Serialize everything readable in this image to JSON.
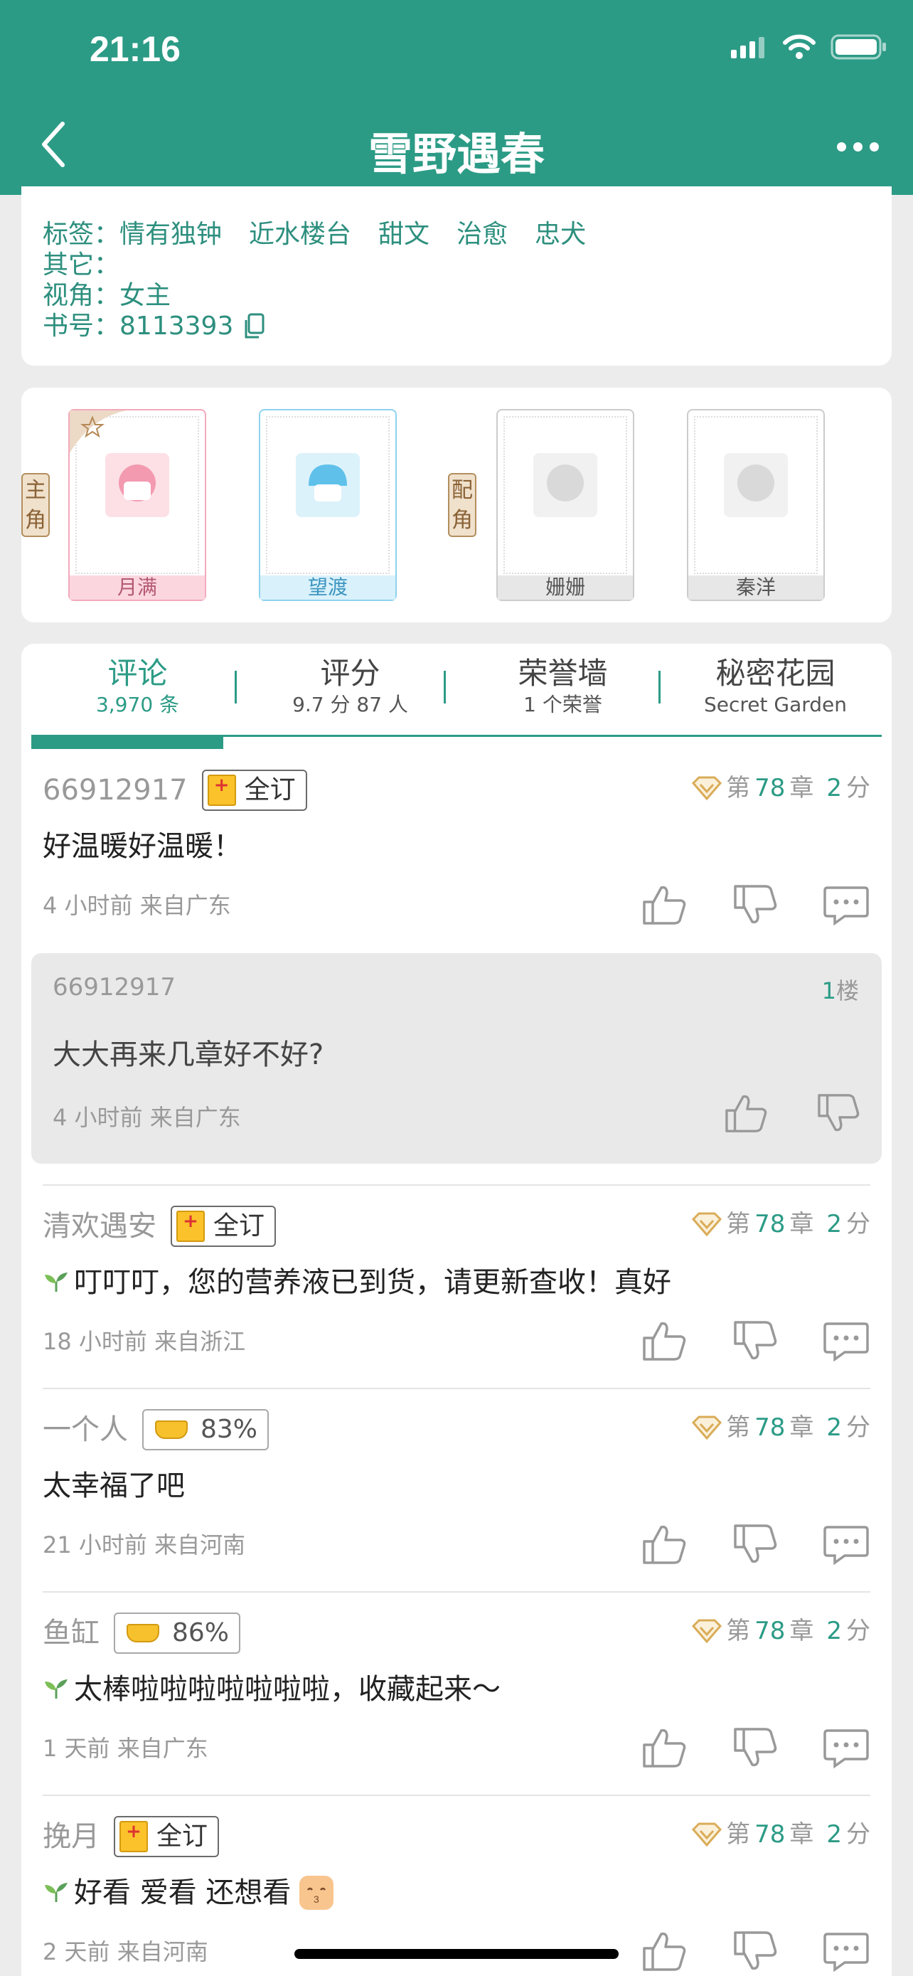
{
  "status_bar": {
    "time": "21:16"
  },
  "nav": {
    "title": "雪野遇春"
  },
  "info": {
    "tags_label": "标签：",
    "tags": [
      "情有独钟",
      "近水楼台",
      "甜文",
      "治愈",
      "忠犬"
    ],
    "other_label": "其它：",
    "view_label": "视角：",
    "view_value": "女主",
    "book_id_label": "书号：",
    "book_id": "8113393"
  },
  "characters": {
    "main_label": "主角",
    "supporting_label": "配角",
    "main": [
      "月满",
      "望渡"
    ],
    "supporting": [
      "姗姗",
      "秦洋"
    ]
  },
  "tabs": [
    {
      "label": "评论",
      "sub": "3,970 条"
    },
    {
      "label": "评分",
      "sub": "9.7 分 87 人"
    },
    {
      "label": "荣誉墙",
      "sub": "1 个荣誉"
    },
    {
      "label": "秘密花园",
      "sub": "Secret Garden"
    }
  ],
  "comments": [
    {
      "user": "66912917",
      "badge": "全订",
      "chapter_prefix": "第",
      "chapter_num": "78",
      "chapter_mid": "章",
      "score_num": "2",
      "score_suffix": "分",
      "text": "好温暖好温暖！",
      "meta": "4 小时前  来自广东"
    },
    {
      "user": "清欢遇安",
      "badge": "全订",
      "chapter_prefix": "第",
      "chapter_num": "78",
      "chapter_mid": "章",
      "score_num": "2",
      "score_suffix": "分",
      "text": "叮叮叮，您的营养液已到货，请更新查收！真好",
      "meta": "18 小时前  来自浙江"
    },
    {
      "user": "一个人",
      "badge": "83%",
      "chapter_prefix": "第",
      "chapter_num": "78",
      "chapter_mid": "章",
      "score_num": "2",
      "score_suffix": "分",
      "text": "太幸福了吧",
      "meta": "21 小时前  来自河南"
    },
    {
      "user": "鱼缸",
      "badge": "86%",
      "chapter_prefix": "第",
      "chapter_num": "78",
      "chapter_mid": "章",
      "score_num": "2",
      "score_suffix": "分",
      "text": "太棒啦啦啦啦啦啦啦，收藏起来～",
      "meta": "1 天前  来自广东"
    },
    {
      "user": "挽月",
      "badge": "全订",
      "chapter_prefix": "第",
      "chapter_num": "78",
      "chapter_mid": "章",
      "score_num": "2",
      "score_suffix": "分",
      "text": "好看 爱看 还想看",
      "meta": "2 天前  来自河南"
    }
  ],
  "reply": {
    "user": "66912917",
    "floor_num": "1",
    "floor_suffix": "楼",
    "text": "大大再来几章好不好?",
    "meta": "4 小时前  来自广东"
  },
  "icons": {
    "like": "thumbs-up-icon",
    "dislike": "thumbs-down-icon",
    "reply": "comment-icon",
    "copy": "copy-icon",
    "chapter": "diamond-icon"
  },
  "colors": {
    "primary": "#2c9b86",
    "background": "#ececec"
  }
}
